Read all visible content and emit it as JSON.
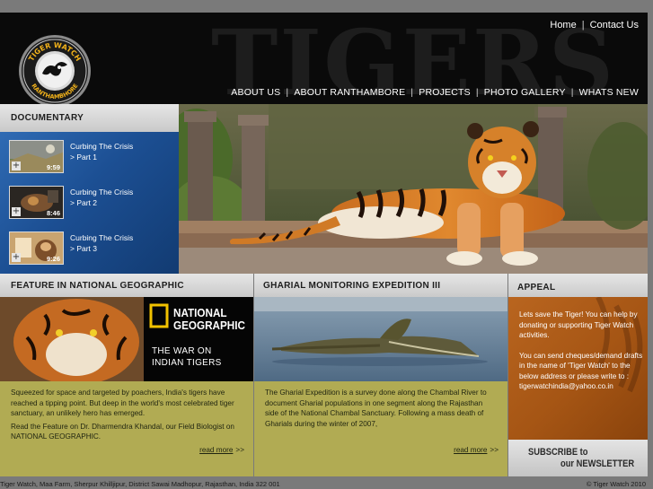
{
  "header": {
    "watermark": "TIGERS",
    "logo": {
      "top_text": "TIGER WATCH",
      "bottom_text": "RANTHAMBHORE"
    },
    "top_links": [
      "Home",
      "Contact Us"
    ],
    "nav": [
      "ABOUT US",
      "ABOUT RANTHAMBORE",
      "PROJECTS",
      "PHOTO GALLERY",
      "WHATS NEW"
    ]
  },
  "documentary": {
    "title": "DOCUMENTARY",
    "videos": [
      {
        "title": "Curbing The Crisis",
        "part": "> Part 1",
        "duration": "9:59"
      },
      {
        "title": "Curbing The Crisis",
        "part": "> Part 2",
        "duration": "8:46"
      },
      {
        "title": "Curbing The Crisis",
        "part": "> Part 3",
        "duration": "9:26"
      }
    ]
  },
  "feature": {
    "title": "FEATURE IN NATIONAL GEOGRAPHIC",
    "brand_line1": "NATIONAL",
    "brand_line2": "GEOGRAPHIC",
    "banner_line1": "THE WAR ON",
    "banner_line2": "INDIAN TIGERS",
    "para1": "Squeezed for space and targeted by poachers, India's tigers have reached a tipping point. But deep in the world's most celebrated tiger sanctuary, an unlikely hero has emerged.",
    "para2": "Read the Feature on Dr. Dharmendra Khandal, our Field Biologist on NATIONAL GEOGRAPHIC.",
    "read_more": "read more",
    "arrows": ">>"
  },
  "gharial": {
    "title": "GHARIAL MONITORING EXPEDITION III",
    "para": "The Gharial Expedition is a survey done along the Chambal River to document Gharial populations in one segment along the Rajasthan side of the National Chambal Sanctuary. Following a mass death of Gharials during the winter of 2007,",
    "read_more": "read more",
    "arrows": ">>"
  },
  "appeal": {
    "title": "APPEAL",
    "para1": "Lets save the Tiger! You can help by donating or supporting Tiger Watch activities.",
    "para2": "You can send cheques/demand drafts in the name of 'Tiger Watch' to the below address or please write to : tigerwatchindia@yahoo.co.in"
  },
  "newsletter": {
    "line1": "SUBSCRIBE to",
    "line2": "our NEWSLETTER"
  },
  "footer": {
    "address": "Tiger Watch, Maa Farm, Sherpur Khilljipur, District Sawai Madhopur, Rajasthan, India 322 001",
    "copyright": "© Tiger Watch 2010"
  },
  "colors": {
    "header_bg": "#0a0a0a",
    "doc_blue": "#1c4f93",
    "olive": "#b1ab53",
    "appeal_orange": "#a55514",
    "natgeo_yellow": "#f2c200"
  }
}
